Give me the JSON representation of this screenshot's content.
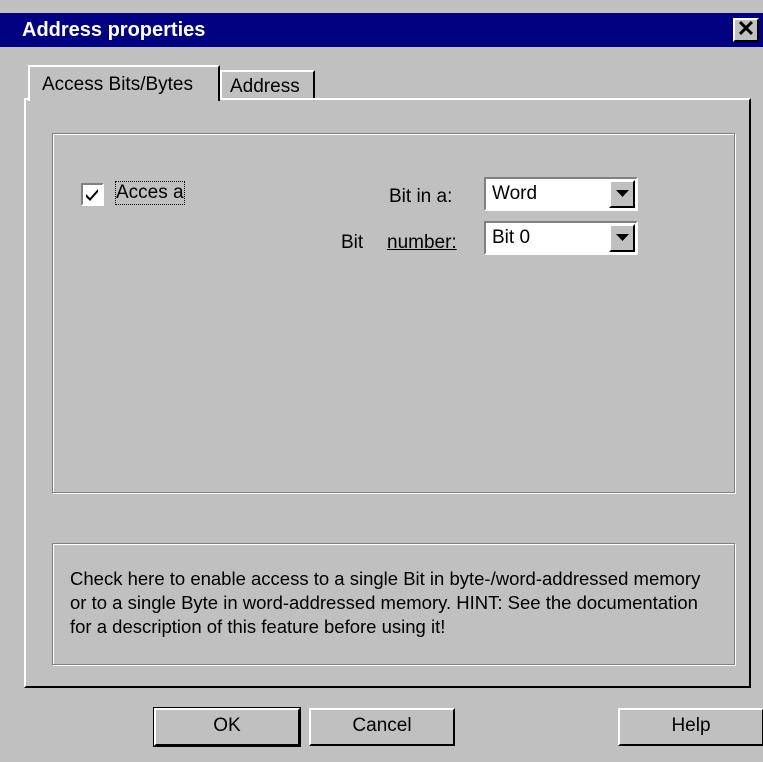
{
  "window": {
    "title": "Address properties",
    "close_glyph": "✕"
  },
  "tabs": [
    {
      "label": "Access Bits/Bytes",
      "active": true
    },
    {
      "label": "Address",
      "active": false
    }
  ],
  "access": {
    "checkbox_label": "Acces a",
    "checked": true
  },
  "bit_in": {
    "label": "Bit in a:",
    "value": "Word"
  },
  "bit_number": {
    "label_prefix": "Bit",
    "label": "number:",
    "value": "Bit 0"
  },
  "hint_text": "Check here to enable access to a single Bit in byte-/word-addressed memory or to a single Byte in word-addressed memory. HINT: See the documentation for a description of this feature before using it!",
  "buttons": {
    "ok": "OK",
    "cancel": "Cancel",
    "help": "Help"
  },
  "colors": {
    "face": "#c0c0c0",
    "titlebar": "#000080",
    "highlight": "#ffffff",
    "shadow": "#808080"
  }
}
